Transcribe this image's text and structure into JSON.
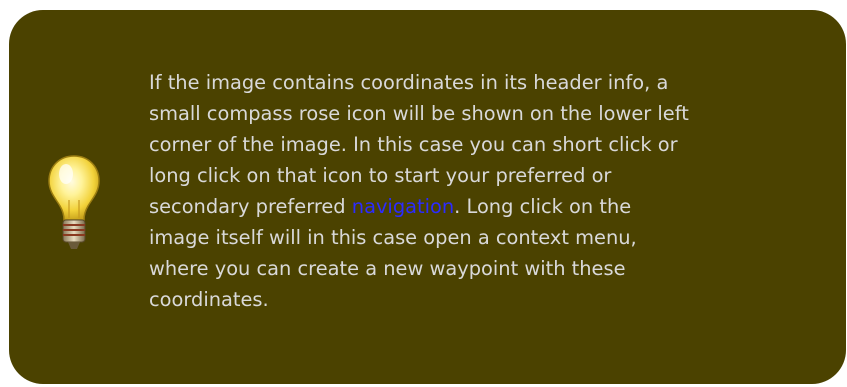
{
  "tip": {
    "icon": "lightbulb-icon",
    "background_color": "#4b4200",
    "text_color": "#d9d9d9",
    "link_color": "#2b2bff",
    "text_before_link": "If the image contains coordinates in its header info, a\nsmall compass rose icon will be shown on the lower left\ncorner of the image. In this case you can short click or\nlong click on that icon to start your preferred or\nsecondary preferred ",
    "link_text": "navigation",
    "text_after_link": ". Long click on the\nimage itself will in this case open a context menu,\nwhere you can create a new waypoint with these\ncoordinates."
  }
}
